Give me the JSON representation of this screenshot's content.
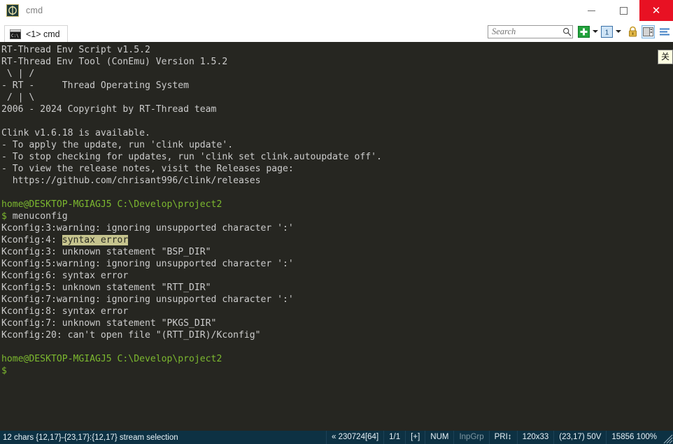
{
  "window": {
    "title": "cmd",
    "icon": "conemu-icon",
    "controls": {
      "minimize": "minimize-button",
      "maximize": "maximize-button",
      "close": "✕"
    },
    "close_color": "#e81123"
  },
  "tabs": [
    {
      "label": "<1> cmd",
      "icon": "cmd-console-icon",
      "active": true
    }
  ],
  "toolbar": {
    "search": {
      "placeholder": "Search",
      "value": ""
    },
    "buttons": [
      {
        "name": "new-console-button",
        "icon": "green-plus-icon"
      },
      {
        "name": "new-console-dropdown",
        "icon": "chevron-down-icon"
      },
      {
        "name": "active-console-button",
        "icon": "console-1-icon",
        "label": "1"
      },
      {
        "name": "active-console-dropdown",
        "icon": "chevron-down-icon"
      },
      {
        "name": "lock-button",
        "icon": "lock-icon"
      },
      {
        "name": "split-pane-button",
        "icon": "split-pane-icon"
      },
      {
        "name": "menu-button",
        "icon": "hamburger-menu-icon"
      }
    ]
  },
  "tooltip": {
    "text": "关"
  },
  "terminal": {
    "background": "#262621",
    "foreground": "#cccccc",
    "prompt_color": "#7cb82f",
    "selection_color": "#c6c48e",
    "lines": [
      {
        "text": "RT-Thread Env Script v1.5.2"
      },
      {
        "text": "RT-Thread Env Tool (ConEmu) Version 1.5.2"
      },
      {
        "text": " \\ | /"
      },
      {
        "text": "- RT -     Thread Operating System"
      },
      {
        "text": " / | \\"
      },
      {
        "text": "2006 - 2024 Copyright by RT-Thread team"
      },
      {
        "text": ""
      },
      {
        "text": "Clink v1.6.18 is available."
      },
      {
        "text": "- To apply the update, run 'clink update'."
      },
      {
        "text": "- To stop checking for updates, run 'clink set clink.autoupdate off'."
      },
      {
        "text": "- To view the release notes, visit the Releases page:"
      },
      {
        "text": "  https://github.com/chrisant996/clink/releases"
      },
      {
        "text": ""
      },
      {
        "text": "home@DESKTOP-MGIAGJ5 C:\\Develop\\project2",
        "style": "green"
      },
      {
        "text": "$ menuconfig",
        "style": "prompt"
      },
      {
        "text": "Kconfig:3:warning: ignoring unsupported character ':'"
      },
      {
        "text": "Kconfig:4: syntax error",
        "selection": {
          "start": 11,
          "end": 23
        }
      },
      {
        "text": "Kconfig:3: unknown statement \"BSP_DIR\""
      },
      {
        "text": "Kconfig:5:warning: ignoring unsupported character ':'"
      },
      {
        "text": "Kconfig:6: syntax error"
      },
      {
        "text": "Kconfig:5: unknown statement \"RTT_DIR\""
      },
      {
        "text": "Kconfig:7:warning: ignoring unsupported character ':'"
      },
      {
        "text": "Kconfig:8: syntax error"
      },
      {
        "text": "Kconfig:7: unknown statement \"PKGS_DIR\""
      },
      {
        "text": "Kconfig:20: can't open file \"(RTT_DIR)/Kconfig\""
      },
      {
        "text": ""
      },
      {
        "text": "home@DESKTOP-MGIAGJ5 C:\\Develop\\project2",
        "style": "green"
      },
      {
        "text": "$",
        "style": "prompt"
      }
    ]
  },
  "statusbar": {
    "background": "#0d3143",
    "left": "12 chars {12,17}-{23,17}:{12,17} stream selection",
    "cells": [
      {
        "text": "« 230724[64]",
        "dim": false
      },
      {
        "text": "1/1",
        "dim": false
      },
      {
        "text": "[+]",
        "dim": false
      },
      {
        "text": "NUM",
        "dim": false
      },
      {
        "text": "InpGrp",
        "dim": true
      },
      {
        "text": "PRI↕",
        "dim": false
      },
      {
        "text": "120x33",
        "dim": false
      },
      {
        "text": "(23,17) 50V",
        "dim": false
      },
      {
        "text": "15856 100%",
        "dim": false
      }
    ]
  }
}
